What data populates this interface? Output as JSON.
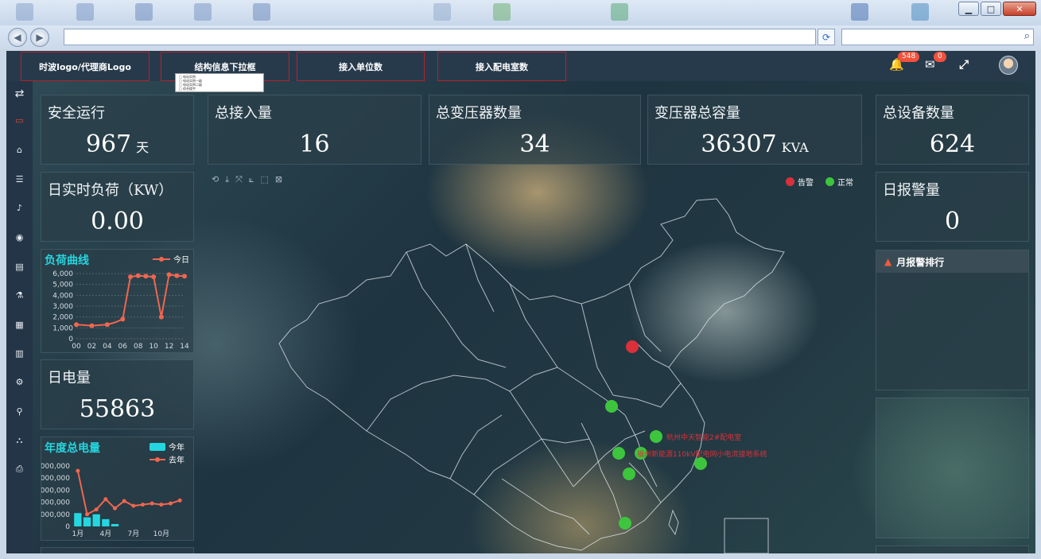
{
  "header": {
    "logo": "时波logo/代理商Logo",
    "dropdown": "结构信息下拉框",
    "access_units": "接入单位数",
    "access_rooms": "接入配电室数",
    "alarm_badge": "548",
    "message_badge": "0",
    "dropdown_lines": [
      "□ 电站实例",
      "□ 电站实例一级",
      "□ 电站实例二级",
      "□ 综合楼宇"
    ]
  },
  "stats": {
    "safe_run": {
      "title": "安全运行",
      "value": "967",
      "unit": "天"
    },
    "total_access": {
      "title": "总接入量",
      "value": "16"
    },
    "total_transformers": {
      "title": "总变压器数量",
      "value": "34"
    },
    "transformer_capacity": {
      "title": "变压器总容量",
      "value": "36307",
      "unit": "KVA"
    },
    "total_devices": {
      "title": "总设备数量",
      "value": "624"
    },
    "realtime_load": {
      "title": "日实时负荷（KW）",
      "value": "0.00"
    },
    "daily_power": {
      "title": "日电量",
      "value": "55863"
    },
    "daily_alarms": {
      "title": "日报警量",
      "value": "0"
    }
  },
  "load_chart": {
    "title": "负荷曲线",
    "legend": "今日",
    "y_ticks": [
      "6,000",
      "5,000",
      "4,000",
      "3,000",
      "2,000",
      "1,000",
      "0"
    ],
    "x_ticks": [
      "00",
      "02",
      "04",
      "06",
      "08",
      "10",
      "12",
      "14"
    ]
  },
  "annual_chart": {
    "title": "年度总电量",
    "legend_current": "今年",
    "legend_last": "去年",
    "y_ticks": [
      "000,000",
      "000,000",
      "000,000",
      "000,000",
      "000,000",
      "0"
    ],
    "x_ticks": [
      "1月",
      "4月",
      "7月",
      "10月"
    ]
  },
  "chart_data": [
    {
      "type": "line",
      "title": "负荷曲线",
      "x": [
        "00",
        "01",
        "02",
        "03",
        "04",
        "05",
        "06",
        "07",
        "08",
        "09",
        "10",
        "11",
        "12",
        "13",
        "14"
      ],
      "series": [
        {
          "name": "今日",
          "values": [
            1300,
            1250,
            1200,
            1250,
            1300,
            1500,
            1800,
            5700,
            5800,
            5750,
            5700,
            2000,
            5900,
            5800,
            5750
          ]
        }
      ],
      "ylim": [
        0,
        6000
      ]
    },
    {
      "type": "bar",
      "title": "年度总电量",
      "series": [
        {
          "name": "今年",
          "values": [
            0.22,
            0.15,
            0.2,
            0.12,
            0.04
          ]
        },
        {
          "name": "去年",
          "values": [
            0.92,
            0.2,
            0.28,
            0.45,
            0.3,
            0.42,
            0.34,
            0.36,
            0.38,
            0.36,
            0.38,
            0.43
          ]
        }
      ],
      "ylim": [
        0,
        1
      ]
    }
  ],
  "map": {
    "legend_alarm": "告警",
    "legend_normal": "正常",
    "colors": {
      "alarm": "#d9303a",
      "normal": "#3ec53e"
    },
    "labels": [
      "杭州中天智能2#配电室",
      "福州新能源110kV配电网小电流接地系统"
    ]
  },
  "rank": {
    "title": "月报警排行"
  },
  "colors": {
    "accent": "#25d6e0",
    "line": "#f06650",
    "border_red": "#b3222d"
  }
}
